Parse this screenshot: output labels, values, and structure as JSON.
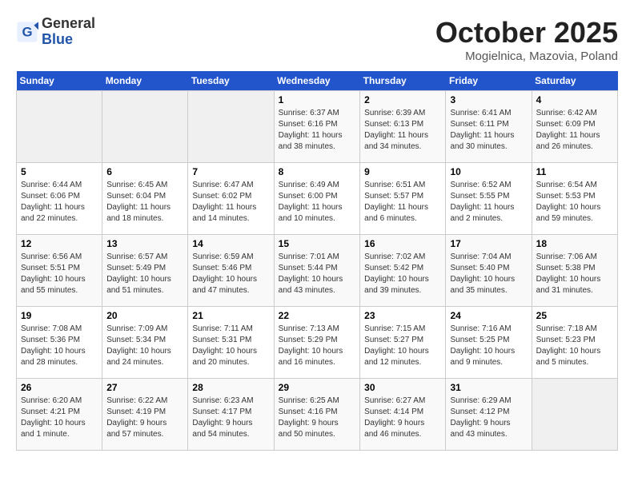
{
  "header": {
    "logo_general": "General",
    "logo_blue": "Blue",
    "title": "October 2025",
    "subtitle": "Mogielnica, Mazovia, Poland"
  },
  "weekdays": [
    "Sunday",
    "Monday",
    "Tuesday",
    "Wednesday",
    "Thursday",
    "Friday",
    "Saturday"
  ],
  "weeks": [
    [
      {
        "num": "",
        "info": ""
      },
      {
        "num": "",
        "info": ""
      },
      {
        "num": "",
        "info": ""
      },
      {
        "num": "1",
        "info": "Sunrise: 6:37 AM\nSunset: 6:16 PM\nDaylight: 11 hours\nand 38 minutes."
      },
      {
        "num": "2",
        "info": "Sunrise: 6:39 AM\nSunset: 6:13 PM\nDaylight: 11 hours\nand 34 minutes."
      },
      {
        "num": "3",
        "info": "Sunrise: 6:41 AM\nSunset: 6:11 PM\nDaylight: 11 hours\nand 30 minutes."
      },
      {
        "num": "4",
        "info": "Sunrise: 6:42 AM\nSunset: 6:09 PM\nDaylight: 11 hours\nand 26 minutes."
      }
    ],
    [
      {
        "num": "5",
        "info": "Sunrise: 6:44 AM\nSunset: 6:06 PM\nDaylight: 11 hours\nand 22 minutes."
      },
      {
        "num": "6",
        "info": "Sunrise: 6:45 AM\nSunset: 6:04 PM\nDaylight: 11 hours\nand 18 minutes."
      },
      {
        "num": "7",
        "info": "Sunrise: 6:47 AM\nSunset: 6:02 PM\nDaylight: 11 hours\nand 14 minutes."
      },
      {
        "num": "8",
        "info": "Sunrise: 6:49 AM\nSunset: 6:00 PM\nDaylight: 11 hours\nand 10 minutes."
      },
      {
        "num": "9",
        "info": "Sunrise: 6:51 AM\nSunset: 5:57 PM\nDaylight: 11 hours\nand 6 minutes."
      },
      {
        "num": "10",
        "info": "Sunrise: 6:52 AM\nSunset: 5:55 PM\nDaylight: 11 hours\nand 2 minutes."
      },
      {
        "num": "11",
        "info": "Sunrise: 6:54 AM\nSunset: 5:53 PM\nDaylight: 10 hours\nand 59 minutes."
      }
    ],
    [
      {
        "num": "12",
        "info": "Sunrise: 6:56 AM\nSunset: 5:51 PM\nDaylight: 10 hours\nand 55 minutes."
      },
      {
        "num": "13",
        "info": "Sunrise: 6:57 AM\nSunset: 5:49 PM\nDaylight: 10 hours\nand 51 minutes."
      },
      {
        "num": "14",
        "info": "Sunrise: 6:59 AM\nSunset: 5:46 PM\nDaylight: 10 hours\nand 47 minutes."
      },
      {
        "num": "15",
        "info": "Sunrise: 7:01 AM\nSunset: 5:44 PM\nDaylight: 10 hours\nand 43 minutes."
      },
      {
        "num": "16",
        "info": "Sunrise: 7:02 AM\nSunset: 5:42 PM\nDaylight: 10 hours\nand 39 minutes."
      },
      {
        "num": "17",
        "info": "Sunrise: 7:04 AM\nSunset: 5:40 PM\nDaylight: 10 hours\nand 35 minutes."
      },
      {
        "num": "18",
        "info": "Sunrise: 7:06 AM\nSunset: 5:38 PM\nDaylight: 10 hours\nand 31 minutes."
      }
    ],
    [
      {
        "num": "19",
        "info": "Sunrise: 7:08 AM\nSunset: 5:36 PM\nDaylight: 10 hours\nand 28 minutes."
      },
      {
        "num": "20",
        "info": "Sunrise: 7:09 AM\nSunset: 5:34 PM\nDaylight: 10 hours\nand 24 minutes."
      },
      {
        "num": "21",
        "info": "Sunrise: 7:11 AM\nSunset: 5:31 PM\nDaylight: 10 hours\nand 20 minutes."
      },
      {
        "num": "22",
        "info": "Sunrise: 7:13 AM\nSunset: 5:29 PM\nDaylight: 10 hours\nand 16 minutes."
      },
      {
        "num": "23",
        "info": "Sunrise: 7:15 AM\nSunset: 5:27 PM\nDaylight: 10 hours\nand 12 minutes."
      },
      {
        "num": "24",
        "info": "Sunrise: 7:16 AM\nSunset: 5:25 PM\nDaylight: 10 hours\nand 9 minutes."
      },
      {
        "num": "25",
        "info": "Sunrise: 7:18 AM\nSunset: 5:23 PM\nDaylight: 10 hours\nand 5 minutes."
      }
    ],
    [
      {
        "num": "26",
        "info": "Sunrise: 6:20 AM\nSunset: 4:21 PM\nDaylight: 10 hours\nand 1 minute."
      },
      {
        "num": "27",
        "info": "Sunrise: 6:22 AM\nSunset: 4:19 PM\nDaylight: 9 hours\nand 57 minutes."
      },
      {
        "num": "28",
        "info": "Sunrise: 6:23 AM\nSunset: 4:17 PM\nDaylight: 9 hours\nand 54 minutes."
      },
      {
        "num": "29",
        "info": "Sunrise: 6:25 AM\nSunset: 4:16 PM\nDaylight: 9 hours\nand 50 minutes."
      },
      {
        "num": "30",
        "info": "Sunrise: 6:27 AM\nSunset: 4:14 PM\nDaylight: 9 hours\nand 46 minutes."
      },
      {
        "num": "31",
        "info": "Sunrise: 6:29 AM\nSunset: 4:12 PM\nDaylight: 9 hours\nand 43 minutes."
      },
      {
        "num": "",
        "info": ""
      }
    ]
  ]
}
